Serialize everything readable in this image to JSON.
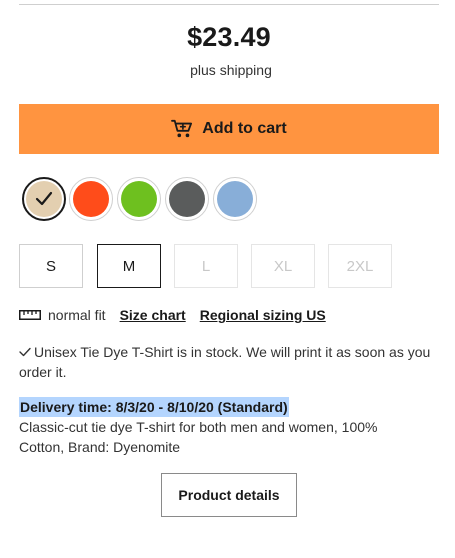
{
  "price": {
    "amount": "$23.49",
    "note": "plus shipping"
  },
  "cart": {
    "label": "Add to cart",
    "icon": "cart-icon",
    "color": "#ff9440"
  },
  "colors": [
    {
      "name": "swatch-beige",
      "hex": "#e3cfb0",
      "selected": true
    },
    {
      "name": "swatch-orange",
      "hex": "#ff4c1a",
      "selected": false
    },
    {
      "name": "swatch-green",
      "hex": "#6ec01f",
      "selected": false
    },
    {
      "name": "swatch-dark-grey",
      "hex": "#5a5c5c",
      "selected": false
    },
    {
      "name": "swatch-light-blue",
      "hex": "#88aed8",
      "selected": false
    }
  ],
  "sizes": [
    {
      "label": "S",
      "state": "available"
    },
    {
      "label": "M",
      "state": "selected"
    },
    {
      "label": "L",
      "state": "unavailable"
    },
    {
      "label": "XL",
      "state": "unavailable"
    },
    {
      "label": "2XL",
      "state": "unavailable"
    }
  ],
  "fit": {
    "icon": "ruler-icon",
    "text": "normal fit",
    "size_chart": "Size chart",
    "regional": "Regional sizing US"
  },
  "stock": {
    "icon": "check-icon",
    "text": "Unisex Tie Dye T-Shirt is in stock. We will print it as soon as you order it."
  },
  "delivery": {
    "text": "Delivery time: 8/3/20 - 8/10/20 (Standard)",
    "highlight": "#b4d5fe"
  },
  "description": "Classic-cut tie dye T-shirt for both men and women, 100% Cotton, Brand: Dyenomite",
  "details_button": "Product details"
}
